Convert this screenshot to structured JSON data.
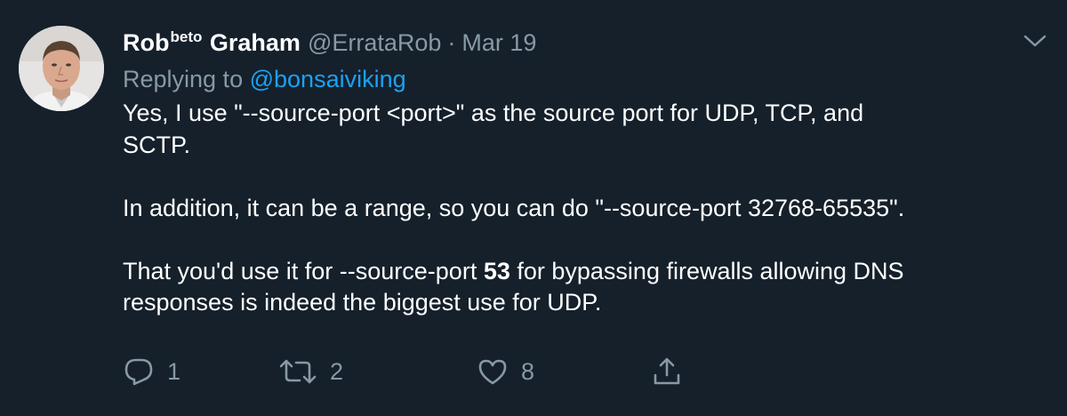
{
  "author": {
    "name_first": "Rob",
    "name_sup": "beto",
    "name_last": "Graham",
    "handle": "@ErrataRob",
    "separator": "·",
    "date": "Mar 19"
  },
  "reply": {
    "prefix": "Replying to",
    "mention": "@bonsaiviking"
  },
  "body": {
    "paragraph1": "Yes, I use \"--source-port <port>\" as the source port for UDP, TCP, and\nSCTP.",
    "paragraph2": "In addition, it can be a range, so you can do \"--source-port 32768-65535\".",
    "paragraph3_before": "That you'd use it for --source-port ",
    "paragraph3_bold": "53",
    "paragraph3_after": " for bypassing firewalls allowing DNS\nresponses is indeed the biggest use for UDP."
  },
  "actions": {
    "reply_count": "1",
    "retweet_count": "2",
    "like_count": "8",
    "reply_icon": "speech-bubble-icon",
    "retweet_icon": "retweet-arrows-icon",
    "like_icon": "heart-icon",
    "share_icon": "share-upload-icon"
  },
  "colors": {
    "background": "#15202b",
    "primary_text": "#ffffff",
    "secondary_text": "#8899a6",
    "link": "#1da1f2"
  }
}
